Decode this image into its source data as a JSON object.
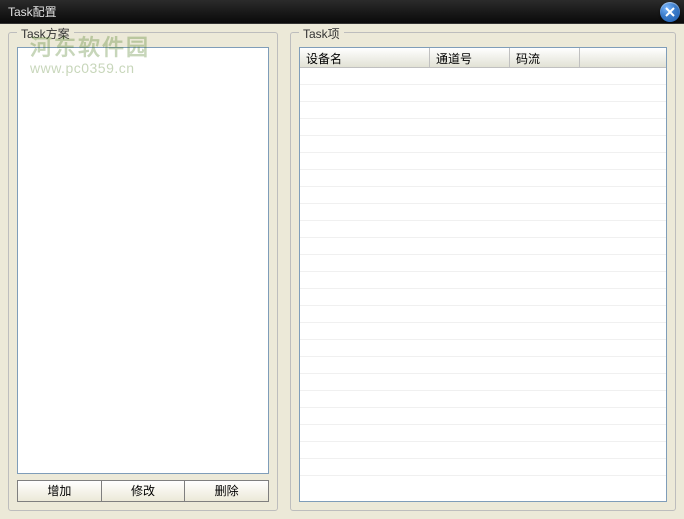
{
  "window": {
    "title": "Task配置"
  },
  "watermark": {
    "text": "河东软件园",
    "url": "www.pc0359.cn"
  },
  "leftPanel": {
    "label": "Task方案",
    "items": []
  },
  "rightPanel": {
    "label": "Task项",
    "columns": [
      "设备名",
      "通道号",
      "码流",
      ""
    ],
    "rows": []
  },
  "buttons": {
    "add": "增加",
    "edit": "修改",
    "delete": "删除"
  }
}
